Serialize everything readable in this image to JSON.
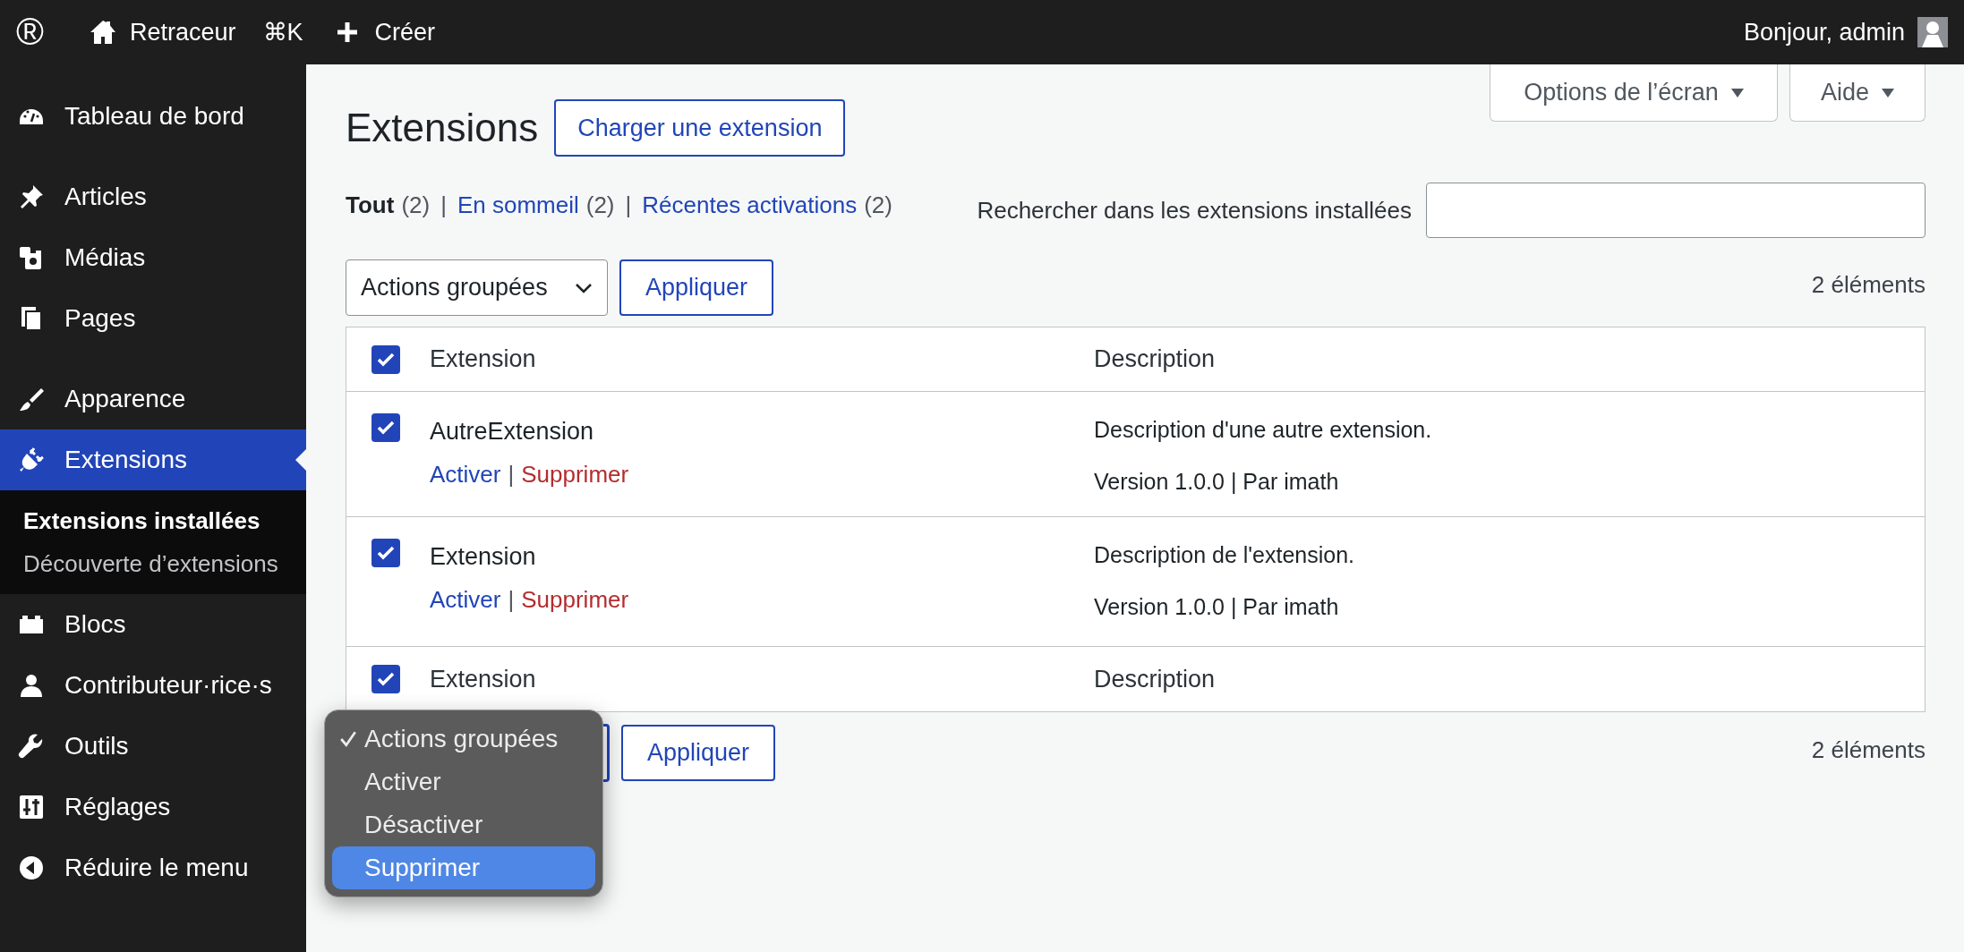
{
  "topbar": {
    "logo": "®",
    "site": "Retraceur",
    "shortcut": "⌘K",
    "new": "Créer",
    "greeting": "Bonjour, admin"
  },
  "sidebar": {
    "groups": [
      {
        "items": [
          {
            "label": "Tableau de bord",
            "selected": false
          }
        ]
      },
      {
        "items": [
          {
            "label": "Articles",
            "selected": false
          },
          {
            "label": "Médias",
            "selected": false
          },
          {
            "label": "Pages",
            "selected": false
          }
        ]
      },
      {
        "items": [
          {
            "label": "Apparence",
            "selected": false
          },
          {
            "label": "Extensions",
            "selected": true,
            "children": [
              {
                "label": "Extensions installées",
                "selected": true
              },
              {
                "label": "Découverte d’extensions",
                "selected": false
              }
            ]
          },
          {
            "label": "Blocs",
            "selected": false
          },
          {
            "label": "Contributeur·rice·s",
            "selected": false
          },
          {
            "label": "Outils",
            "selected": false
          },
          {
            "label": "Réglages",
            "selected": false
          }
        ]
      }
    ],
    "collapse": "Réduire le menu"
  },
  "header": {
    "title": "Extensions",
    "upload_button": "Charger une extension",
    "screen_options": "Options de l’écran",
    "help": "Aide"
  },
  "filters": [
    {
      "kind": "filter",
      "label": "Tout",
      "count": "(2)",
      "selected": true
    },
    {
      "kind": "separator",
      "label": "|"
    },
    {
      "kind": "filter",
      "label": "En sommeil",
      "count": "(2)",
      "selected": false
    },
    {
      "kind": "separator",
      "label": "|"
    },
    {
      "kind": "filter",
      "label": "Récentes activations",
      "count": "(2)",
      "selected": false
    }
  ],
  "search": {
    "label": "Rechercher dans les extensions installées"
  },
  "top_actions": {
    "select": "Actions groupées",
    "apply": "Appliquer",
    "count": "2 éléments"
  },
  "table": {
    "columns": [
      "Extension",
      "Description"
    ],
    "header_checked": true,
    "footer_checked": true,
    "footer_columns": [
      "Extension",
      "Description"
    ],
    "rows": [
      {
        "name": "AutreExtension",
        "checked": true,
        "actions": [
          {
            "kind": "link",
            "label": "Activer"
          },
          {
            "kind": "separator",
            "label": "|"
          },
          {
            "kind": "delete",
            "label": "Supprimer"
          }
        ],
        "description": "Description d'une autre extension.",
        "meta": "Version 1.0.0 | Par imath"
      },
      {
        "name": "Extension",
        "checked": true,
        "actions": [
          {
            "kind": "link",
            "label": "Activer"
          },
          {
            "kind": "separator",
            "label": "|"
          },
          {
            "kind": "delete",
            "label": "Supprimer"
          }
        ],
        "description": "Description de l'extension.",
        "meta": "Version 1.0.0 | Par imath"
      }
    ]
  },
  "bottom_actions": {
    "apply": "Appliquer",
    "count": "2 éléments"
  },
  "dropdown": {
    "options": [
      {
        "label": "Actions groupées",
        "checked": true,
        "selected": false
      },
      {
        "label": "Activer",
        "checked": false,
        "selected": false
      },
      {
        "label": "Désactiver",
        "checked": false,
        "selected": false
      },
      {
        "label": "Supprimer",
        "checked": false,
        "selected": true
      }
    ]
  }
}
